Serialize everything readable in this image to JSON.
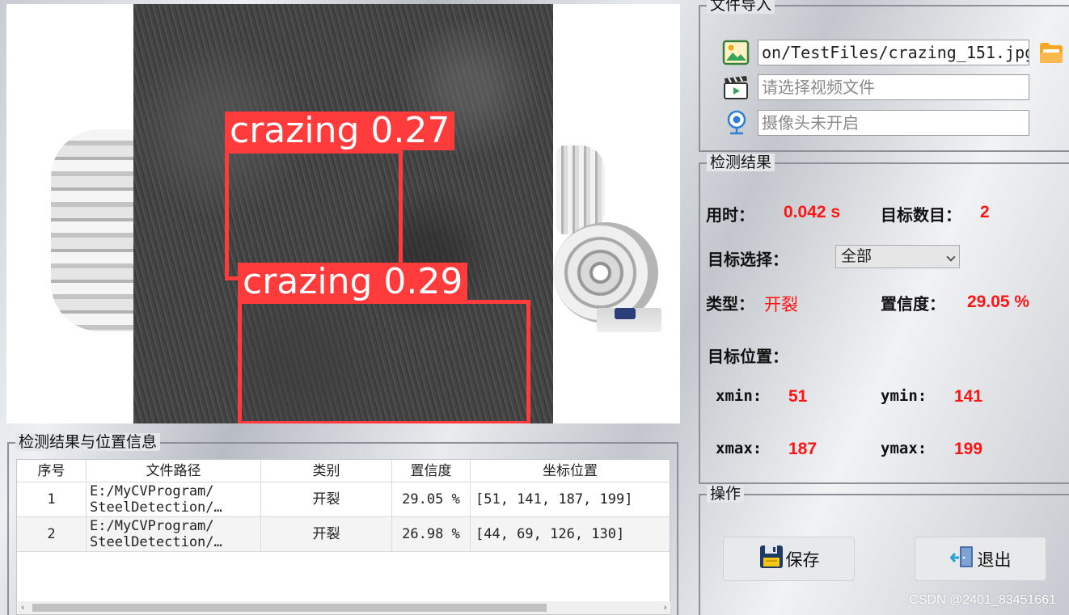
{
  "viewer": {
    "detections": [
      {
        "label": "crazing 0.27"
      },
      {
        "label": "crazing 0.29"
      }
    ]
  },
  "table_group": {
    "title": "检测结果与位置信息",
    "headers": [
      "序号",
      "文件路径",
      "类别",
      "置信度",
      "坐标位置"
    ],
    "rows": [
      {
        "index": "1",
        "path": "E:/MyCVProgram/\nSteelDetection/…",
        "class": "开裂",
        "confidence": "29.05 %",
        "coords": "[51, 141, 187, 199]"
      },
      {
        "index": "2",
        "path": "E:/MyCVProgram/\nSteelDetection/…",
        "class": "开裂",
        "confidence": "26.98 %",
        "coords": "[44, 69, 126, 130]"
      }
    ]
  },
  "file_import": {
    "title": "文件导入",
    "image_path": "on/TestFiles/crazing_151.jpg",
    "video_placeholder": "请选择视频文件",
    "camera_placeholder": "摄像头未开启"
  },
  "results": {
    "title": "检测结果",
    "time_label": "用时：",
    "time_value": "0.042 s",
    "count_label": "目标数目：",
    "count_value": "2",
    "select_label": "目标选择：",
    "select_value": "全部",
    "type_label": "类型：",
    "type_value": "开裂",
    "conf_label": "置信度：",
    "conf_value": "29.05 %",
    "position_label": "目标位置：",
    "xmin_label": "xmin:",
    "xmin_value": "51",
    "ymin_label": "ymin:",
    "ymin_value": "141",
    "xmax_label": "xmax:",
    "xmax_value": "187",
    "ymax_label": "ymax:",
    "ymax_value": "199"
  },
  "operations": {
    "title": "操作",
    "save_label": "保存",
    "exit_label": "退出"
  },
  "watermark": "CSDN @2401_83451661",
  "icons": {
    "image_file": "image-file-icon",
    "folder": "folder-open-icon",
    "video": "video-clapper-icon",
    "camera": "webcam-icon",
    "save": "floppy-disk-icon",
    "exit": "exit-door-icon"
  },
  "colors": {
    "detection_box": "#ff3b3b",
    "result_value": "#ff1414"
  }
}
